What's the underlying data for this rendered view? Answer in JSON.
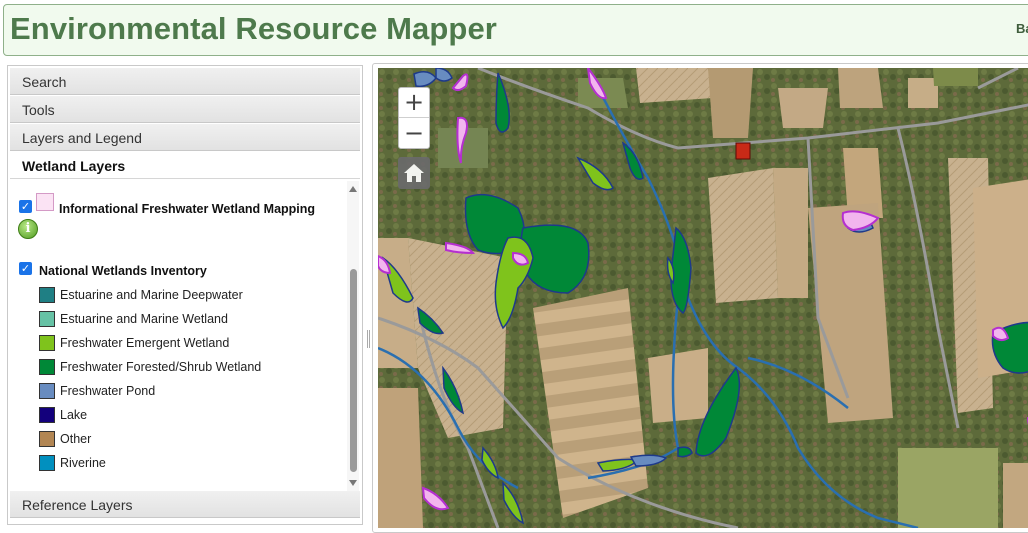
{
  "header": {
    "title": "Environmental Resource Mapper",
    "right_link": "Ba"
  },
  "panel": {
    "sections": [
      "Search",
      "Tools",
      "Layers and Legend",
      "Wetland Layers"
    ],
    "bottom_section": "Reference Layers",
    "info_layer": {
      "label": "Informational Freshwater Wetland Mapping",
      "checked": true
    },
    "nwi_layer": {
      "label": "National Wetlands Inventory",
      "checked": true
    },
    "legend": [
      {
        "label": "Estuarine and Marine Deepwater",
        "color": "#1f7f84"
      },
      {
        "label": "Estuarine and Marine Wetland",
        "color": "#66c2a5"
      },
      {
        "label": "Freshwater Emergent Wetland",
        "color": "#7fc31c"
      },
      {
        "label": "Freshwater Forested/Shrub Wetland",
        "color": "#008837"
      },
      {
        "label": "Freshwater Pond",
        "color": "#688cc0"
      },
      {
        "label": "Lake",
        "color": "#13007c"
      },
      {
        "label": "Other",
        "color": "#b28653"
      },
      {
        "label": "Riverine",
        "color": "#0190bf"
      }
    ]
  },
  "map": {
    "zoom_in_label": "+",
    "zoom_out_label": "−",
    "info_fill_color": "#f2b5ee",
    "info_edge_color": "#b52fd0",
    "river_color": "#2a6fb0",
    "road_color": "#9a9a9a"
  }
}
